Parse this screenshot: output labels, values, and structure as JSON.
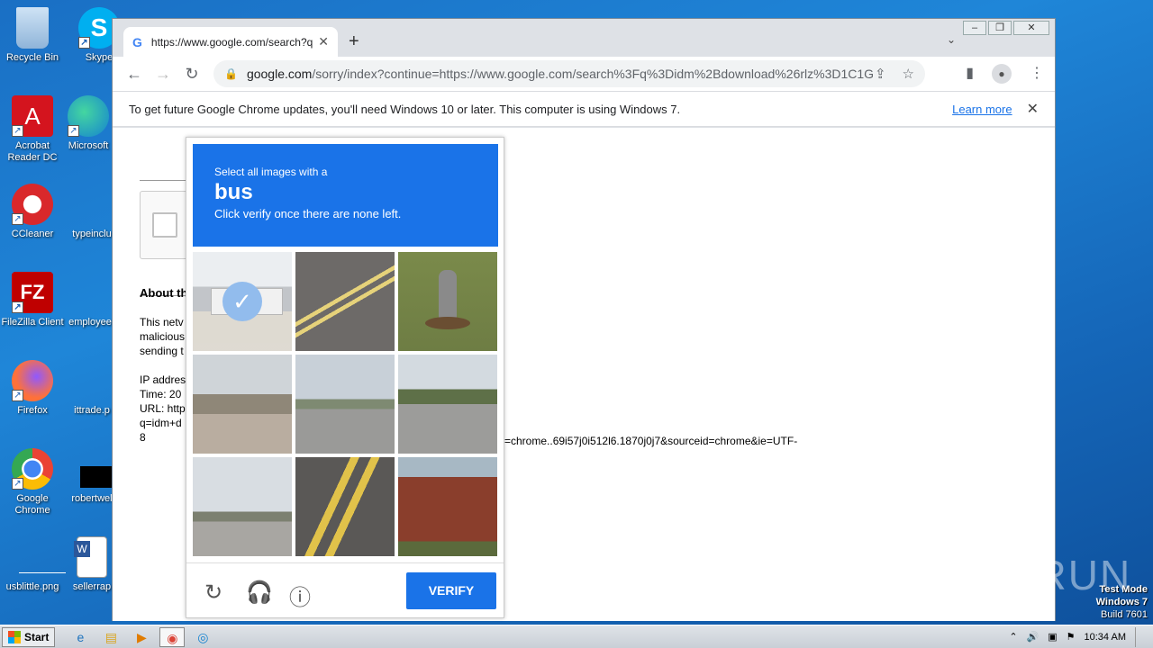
{
  "desktop": {
    "icons": [
      {
        "label": "Recycle Bin",
        "icon": "recycle-bin-icon"
      },
      {
        "label": "Skype",
        "icon": "skype-icon"
      },
      {
        "label": "Acrobat Reader DC",
        "icon": "acrobat-icon"
      },
      {
        "label": "Microsoft",
        "icon": "edge-icon"
      },
      {
        "label": "CCleaner",
        "icon": "ccleaner-icon"
      },
      {
        "label": "typeinclu",
        "icon": "file-icon"
      },
      {
        "label": "FileZilla Client",
        "icon": "filezilla-icon"
      },
      {
        "label": "employee",
        "icon": "file-icon"
      },
      {
        "label": "Firefox",
        "icon": "firefox-icon"
      },
      {
        "label": "ittrade.p",
        "icon": "file-icon"
      },
      {
        "label": "Google Chrome",
        "icon": "chrome-icon"
      },
      {
        "label": "robertwel",
        "icon": "file-icon"
      },
      {
        "label": "usblittle.png",
        "icon": "image-icon"
      },
      {
        "label": "sellerrap",
        "icon": "word-icon"
      }
    ]
  },
  "browser": {
    "tab_title": "https://www.google.com/search?q=",
    "address_host": "google.com",
    "address_rest": "/sorry/index?continue=https://www.google.com/search%3Fq%3Didm%2Bdownload%26rlz%3D1C1G...",
    "infobar_text": "To get future Google Chrome updates, you'll need Windows 10 or later. This computer is using Windows 7.",
    "infobar_link": "Learn more"
  },
  "sorry_page": {
    "about_heading": "About th",
    "para1": [
      "This netv",
      "malicious",
      "sending t"
    ],
    "para2": [
      "IP addres",
      "Time: 20",
      "URL: http",
      "q=idm+d",
      "8"
    ],
    "url_tail": "=chrome..69i57j0i512l6.1870j0j7&sourceid=chrome&ie=UTF-"
  },
  "captcha": {
    "line1": "Select all images with a",
    "keyword": "bus",
    "line3": "Click verify once there are none left.",
    "verify_label": "VERIFY",
    "tiles": [
      {
        "subject": "bus-street",
        "selected": true
      },
      {
        "subject": "road-lines",
        "selected": false
      },
      {
        "subject": "fire-hydrant",
        "selected": false
      },
      {
        "subject": "road-palms",
        "selected": false
      },
      {
        "subject": "highway",
        "selected": false
      },
      {
        "subject": "intersection",
        "selected": false
      },
      {
        "subject": "road-cars",
        "selected": false
      },
      {
        "subject": "yellow-lines",
        "selected": false
      },
      {
        "subject": "brick-house",
        "selected": false
      }
    ]
  },
  "watermark": {
    "brand": "ANY RUN",
    "line1": "Test Mode",
    "line2": "Windows 7",
    "line3": "Build 7601"
  },
  "taskbar": {
    "start_label": "Start",
    "clock": "10:34 AM"
  }
}
